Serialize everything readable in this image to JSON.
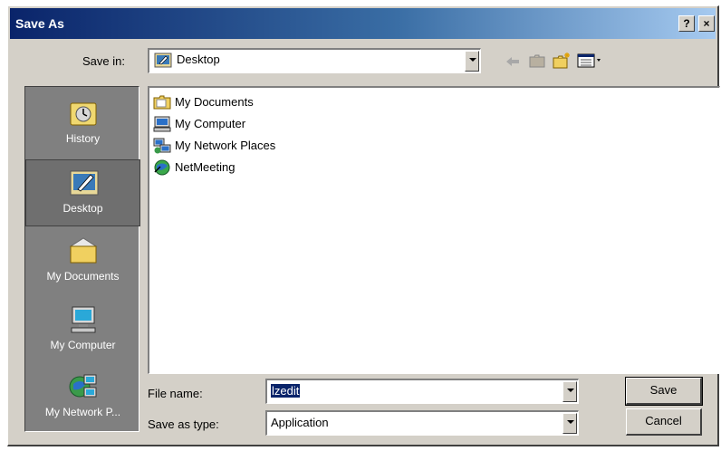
{
  "window": {
    "title": "Save As",
    "help_label": "?",
    "close_label": "×"
  },
  "save_in": {
    "label": "Save in:",
    "value": "Desktop"
  },
  "places": [
    {
      "label": "History",
      "icon": "history-icon"
    },
    {
      "label": "Desktop",
      "icon": "desktop-icon",
      "selected": true
    },
    {
      "label": "My Documents",
      "icon": "my-documents-icon"
    },
    {
      "label": "My Computer",
      "icon": "my-computer-icon"
    },
    {
      "label": "My Network P...",
      "icon": "network-places-icon"
    }
  ],
  "files": [
    {
      "name": "My Documents",
      "icon": "folder-icon"
    },
    {
      "name": "My Computer",
      "icon": "computer-icon"
    },
    {
      "name": "My Network Places",
      "icon": "network-icon"
    },
    {
      "name": "NetMeeting",
      "icon": "netmeeting-icon"
    }
  ],
  "file_name": {
    "label": "File name:",
    "value": "lzedit"
  },
  "save_as_type": {
    "label": "Save as type:",
    "value": "Application"
  },
  "buttons": {
    "save": "Save",
    "cancel": "Cancel"
  }
}
